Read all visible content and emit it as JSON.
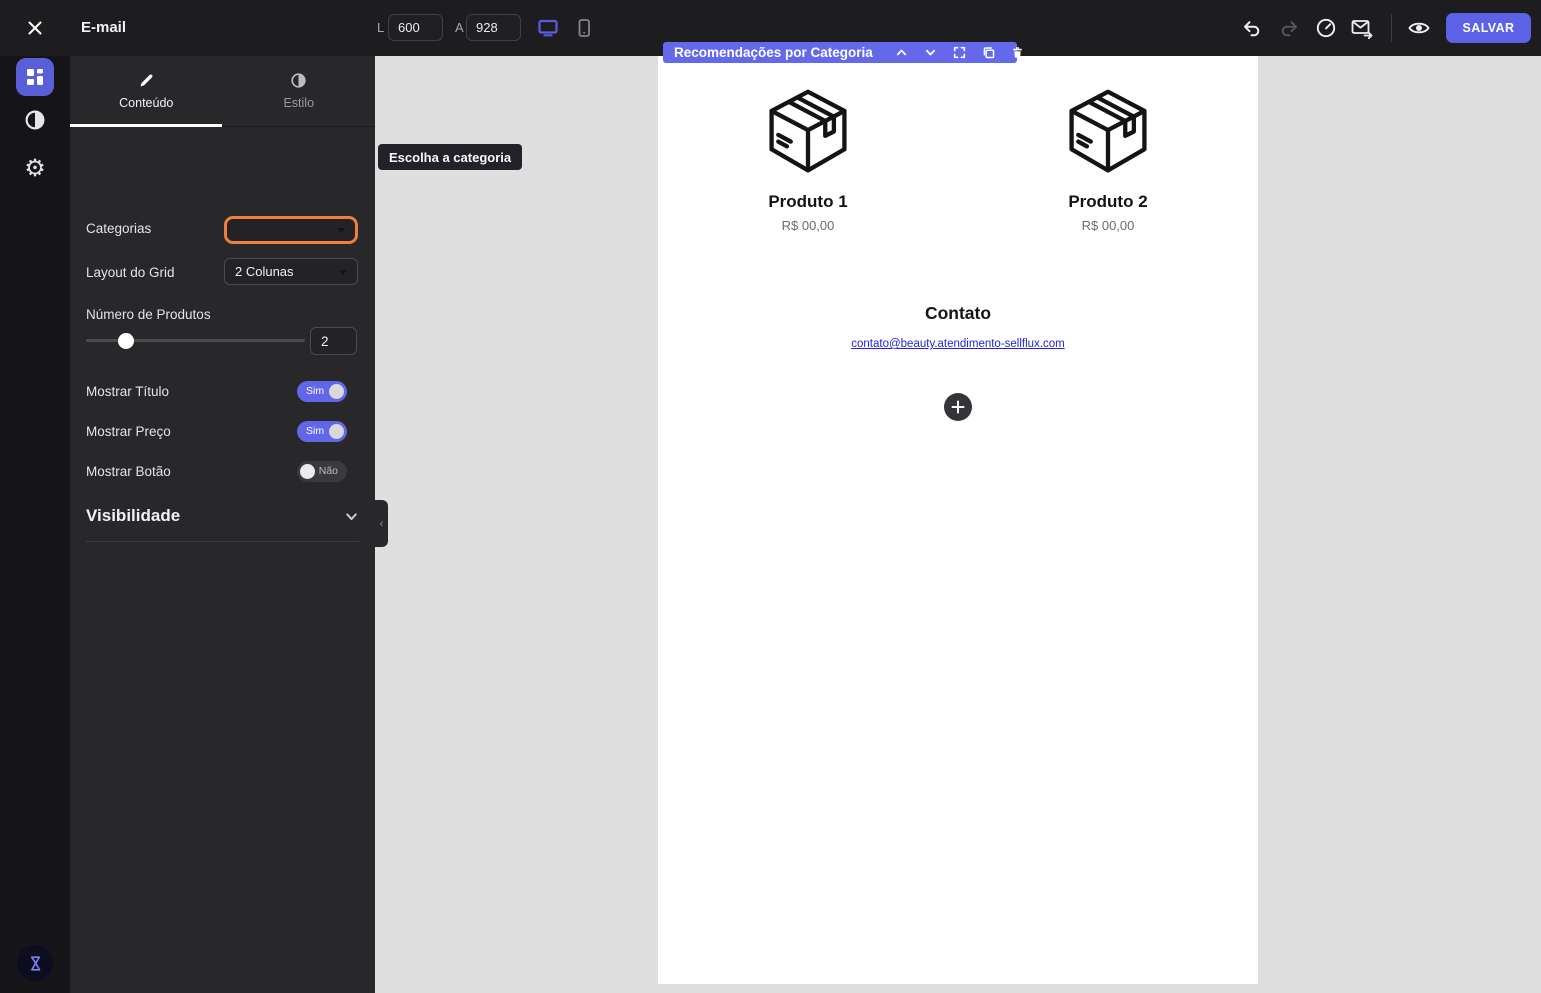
{
  "colors": {
    "accent_purple": "#5c61e6",
    "block_toolbar_purple": "#6468ea",
    "highlight_orange": "#ef7f3d",
    "link_blue": "#2323d5",
    "canvas_gray": "#dfdfdf",
    "panel_dark": "#28282b"
  },
  "topbar": {
    "title": "E-mail",
    "width_label": "L",
    "width_value": "600",
    "height_label": "A",
    "height_value": "928",
    "save_label": "SALVAR"
  },
  "panel": {
    "tab_content": "Conteúdo",
    "tab_style": "Estilo",
    "categories_label": "Categorias",
    "categories_value": "",
    "tooltip": "Escolha a categoria",
    "grid_label": "Layout do Grid",
    "grid_value": "2 Colunas",
    "products_count_label": "Número de Produtos",
    "products_count_value": "2",
    "toggle_title_label": "Mostrar Título",
    "toggle_title_state": "Sim",
    "toggle_price_label": "Mostrar Preço",
    "toggle_price_state": "Sim",
    "toggle_button_label": "Mostrar Botão",
    "toggle_button_state": "Não",
    "visibility_label": "Visibilidade"
  },
  "canvas": {
    "block_label": "Recomendações por Categoria",
    "products": [
      {
        "name": "Produto 1",
        "price": "R$ 00,00"
      },
      {
        "name": "Produto 2",
        "price": "R$ 00,00"
      }
    ],
    "contact_title": "Contato",
    "contact_email": "contato@beauty.atendimento-sellflux.com"
  }
}
